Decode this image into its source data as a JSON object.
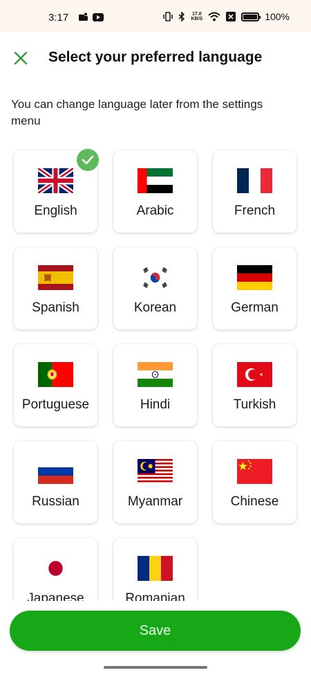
{
  "status_bar": {
    "time": "3:17",
    "net_speed_value": "17.0",
    "net_speed_unit": "KB/S",
    "battery": "100%"
  },
  "header": {
    "close_icon": "close-icon",
    "title": "Select your preferred language"
  },
  "subtitle": "You can change language later from the settings menu",
  "languages": [
    {
      "label": "English",
      "flag": "uk-flag",
      "selected": true
    },
    {
      "label": "Arabic",
      "flag": "uae-flag",
      "selected": false
    },
    {
      "label": "French",
      "flag": "france-flag",
      "selected": false
    },
    {
      "label": "Spanish",
      "flag": "spain-flag",
      "selected": false
    },
    {
      "label": "Korean",
      "flag": "south-korea-flag",
      "selected": false
    },
    {
      "label": "German",
      "flag": "germany-flag",
      "selected": false
    },
    {
      "label": "Portuguese",
      "flag": "portugal-flag",
      "selected": false
    },
    {
      "label": "Hindi",
      "flag": "india-flag",
      "selected": false
    },
    {
      "label": "Turkish",
      "flag": "turkey-flag",
      "selected": false
    },
    {
      "label": "Russian",
      "flag": "russia-flag",
      "selected": false
    },
    {
      "label": "Myanmar",
      "flag": "malaysia-flag",
      "selected": false
    },
    {
      "label": "Chinese",
      "flag": "china-flag",
      "selected": false
    },
    {
      "label": "Japanese",
      "flag": "japan-flag",
      "selected": false
    },
    {
      "label": "Romanian",
      "flag": "romania-flag",
      "selected": false
    }
  ],
  "save_label": "Save",
  "colors": {
    "accent_green": "#17a817",
    "check_green": "#5dba5d",
    "close_green": "#2e9e3a"
  }
}
